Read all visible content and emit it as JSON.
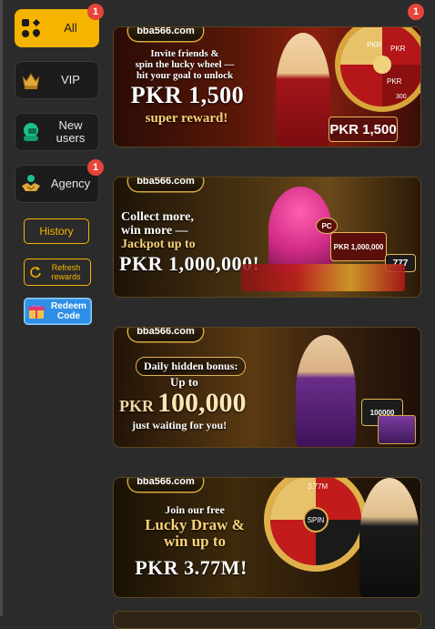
{
  "sidebar": {
    "categories": [
      {
        "label": "All",
        "badge": "1",
        "icon": "grid-suits-icon"
      },
      {
        "label": "VIP",
        "icon": "crown-icon"
      },
      {
        "label": "New users",
        "icon": "new-user-icon"
      },
      {
        "label": "Agency",
        "badge": "1",
        "icon": "handshake-icon"
      }
    ],
    "history_label": "History",
    "refresh_label": "Refresh rewards",
    "redeem_label": "Redeem Code"
  },
  "banners_badge": "1",
  "banners": [
    {
      "logo": "bba566.com",
      "line1": "Invite friends &",
      "line2": "spin the lucky wheel —",
      "line3": "hit your goal to unlock",
      "amount": "PKR 1,500",
      "line4": "super reward!",
      "tag": "PKR 1,500",
      "wheel_labels": [
        "PKR",
        "PKR",
        "PKR",
        "300"
      ]
    },
    {
      "logo": "bba566.com",
      "line1": "Collect more,",
      "line2": "win more —",
      "line3": "Jackpot up to",
      "amount": "PKR 1,000,000!",
      "sign": "PKR 1,000,000",
      "chip": "PC",
      "slots": "777"
    },
    {
      "logo": "bba566.com",
      "line1": "Daily hidden bonus:",
      "line2": "Up to",
      "amount_prefix": "PKR",
      "amount": "100,000",
      "line3": "just waiting for you!",
      "chest": "100000"
    },
    {
      "logo": "bba566.com",
      "line1": "Join our free",
      "line2": "Lucky Draw &",
      "line3": "win up to",
      "amount": "PKR 3.77M!",
      "wheel_center": "SPIN",
      "wheel_top": "3.77M"
    }
  ],
  "colors": {
    "accent": "#f5b400",
    "badge": "#e8443a",
    "redeem": "#2f8fe6",
    "background": "#2b2b2b"
  }
}
